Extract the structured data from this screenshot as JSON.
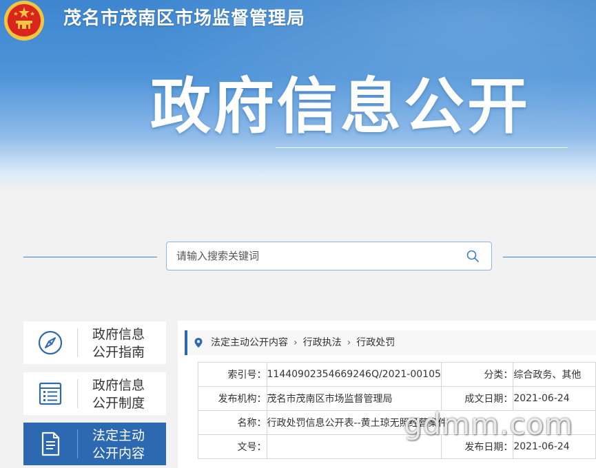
{
  "header": {
    "org_name": "茂名市茂南区市场监督管理局",
    "banner_title": "政府信息公开"
  },
  "search": {
    "placeholder": "请输入搜索关键词"
  },
  "sidebar": {
    "items": [
      {
        "label_line1": "政府信息",
        "label_line2": "公开指南",
        "icon": "compass-icon",
        "active": false
      },
      {
        "label_line1": "政府信息",
        "label_line2": "公开制度",
        "icon": "list-icon",
        "active": false
      },
      {
        "label_line1": "法定主动",
        "label_line2": "公开内容",
        "icon": "document-icon",
        "active": true
      }
    ]
  },
  "breadcrumb": {
    "items": [
      "法定主动公开内容",
      "行政执法",
      "行政处罚"
    ],
    "separator": "›"
  },
  "info_table": {
    "index_label": "索引号：",
    "index_value": "11440902354669246Q/2021-00105",
    "category_label": "分类：",
    "category_value": "综合政务、其他",
    "publisher_label": "发布机构：",
    "publisher_value": "茂名市茂南区市场监督管理局",
    "written_date_label": "成文日期：",
    "written_date_value": "2021-06-24",
    "name_label": "名称：",
    "name_value": "行政处罚信息公开表--黄土琼无照经营案件",
    "doc_no_label": "文号：",
    "doc_no_value": "",
    "publish_date_label": "发布日期：",
    "publish_date_value": "2021-06-24"
  },
  "watermark": "gdmm.com",
  "colors": {
    "primary": "#2c69b0",
    "banner": "#4f94d8",
    "emblem_red": "#d8261c",
    "emblem_gold": "#f5c542"
  }
}
